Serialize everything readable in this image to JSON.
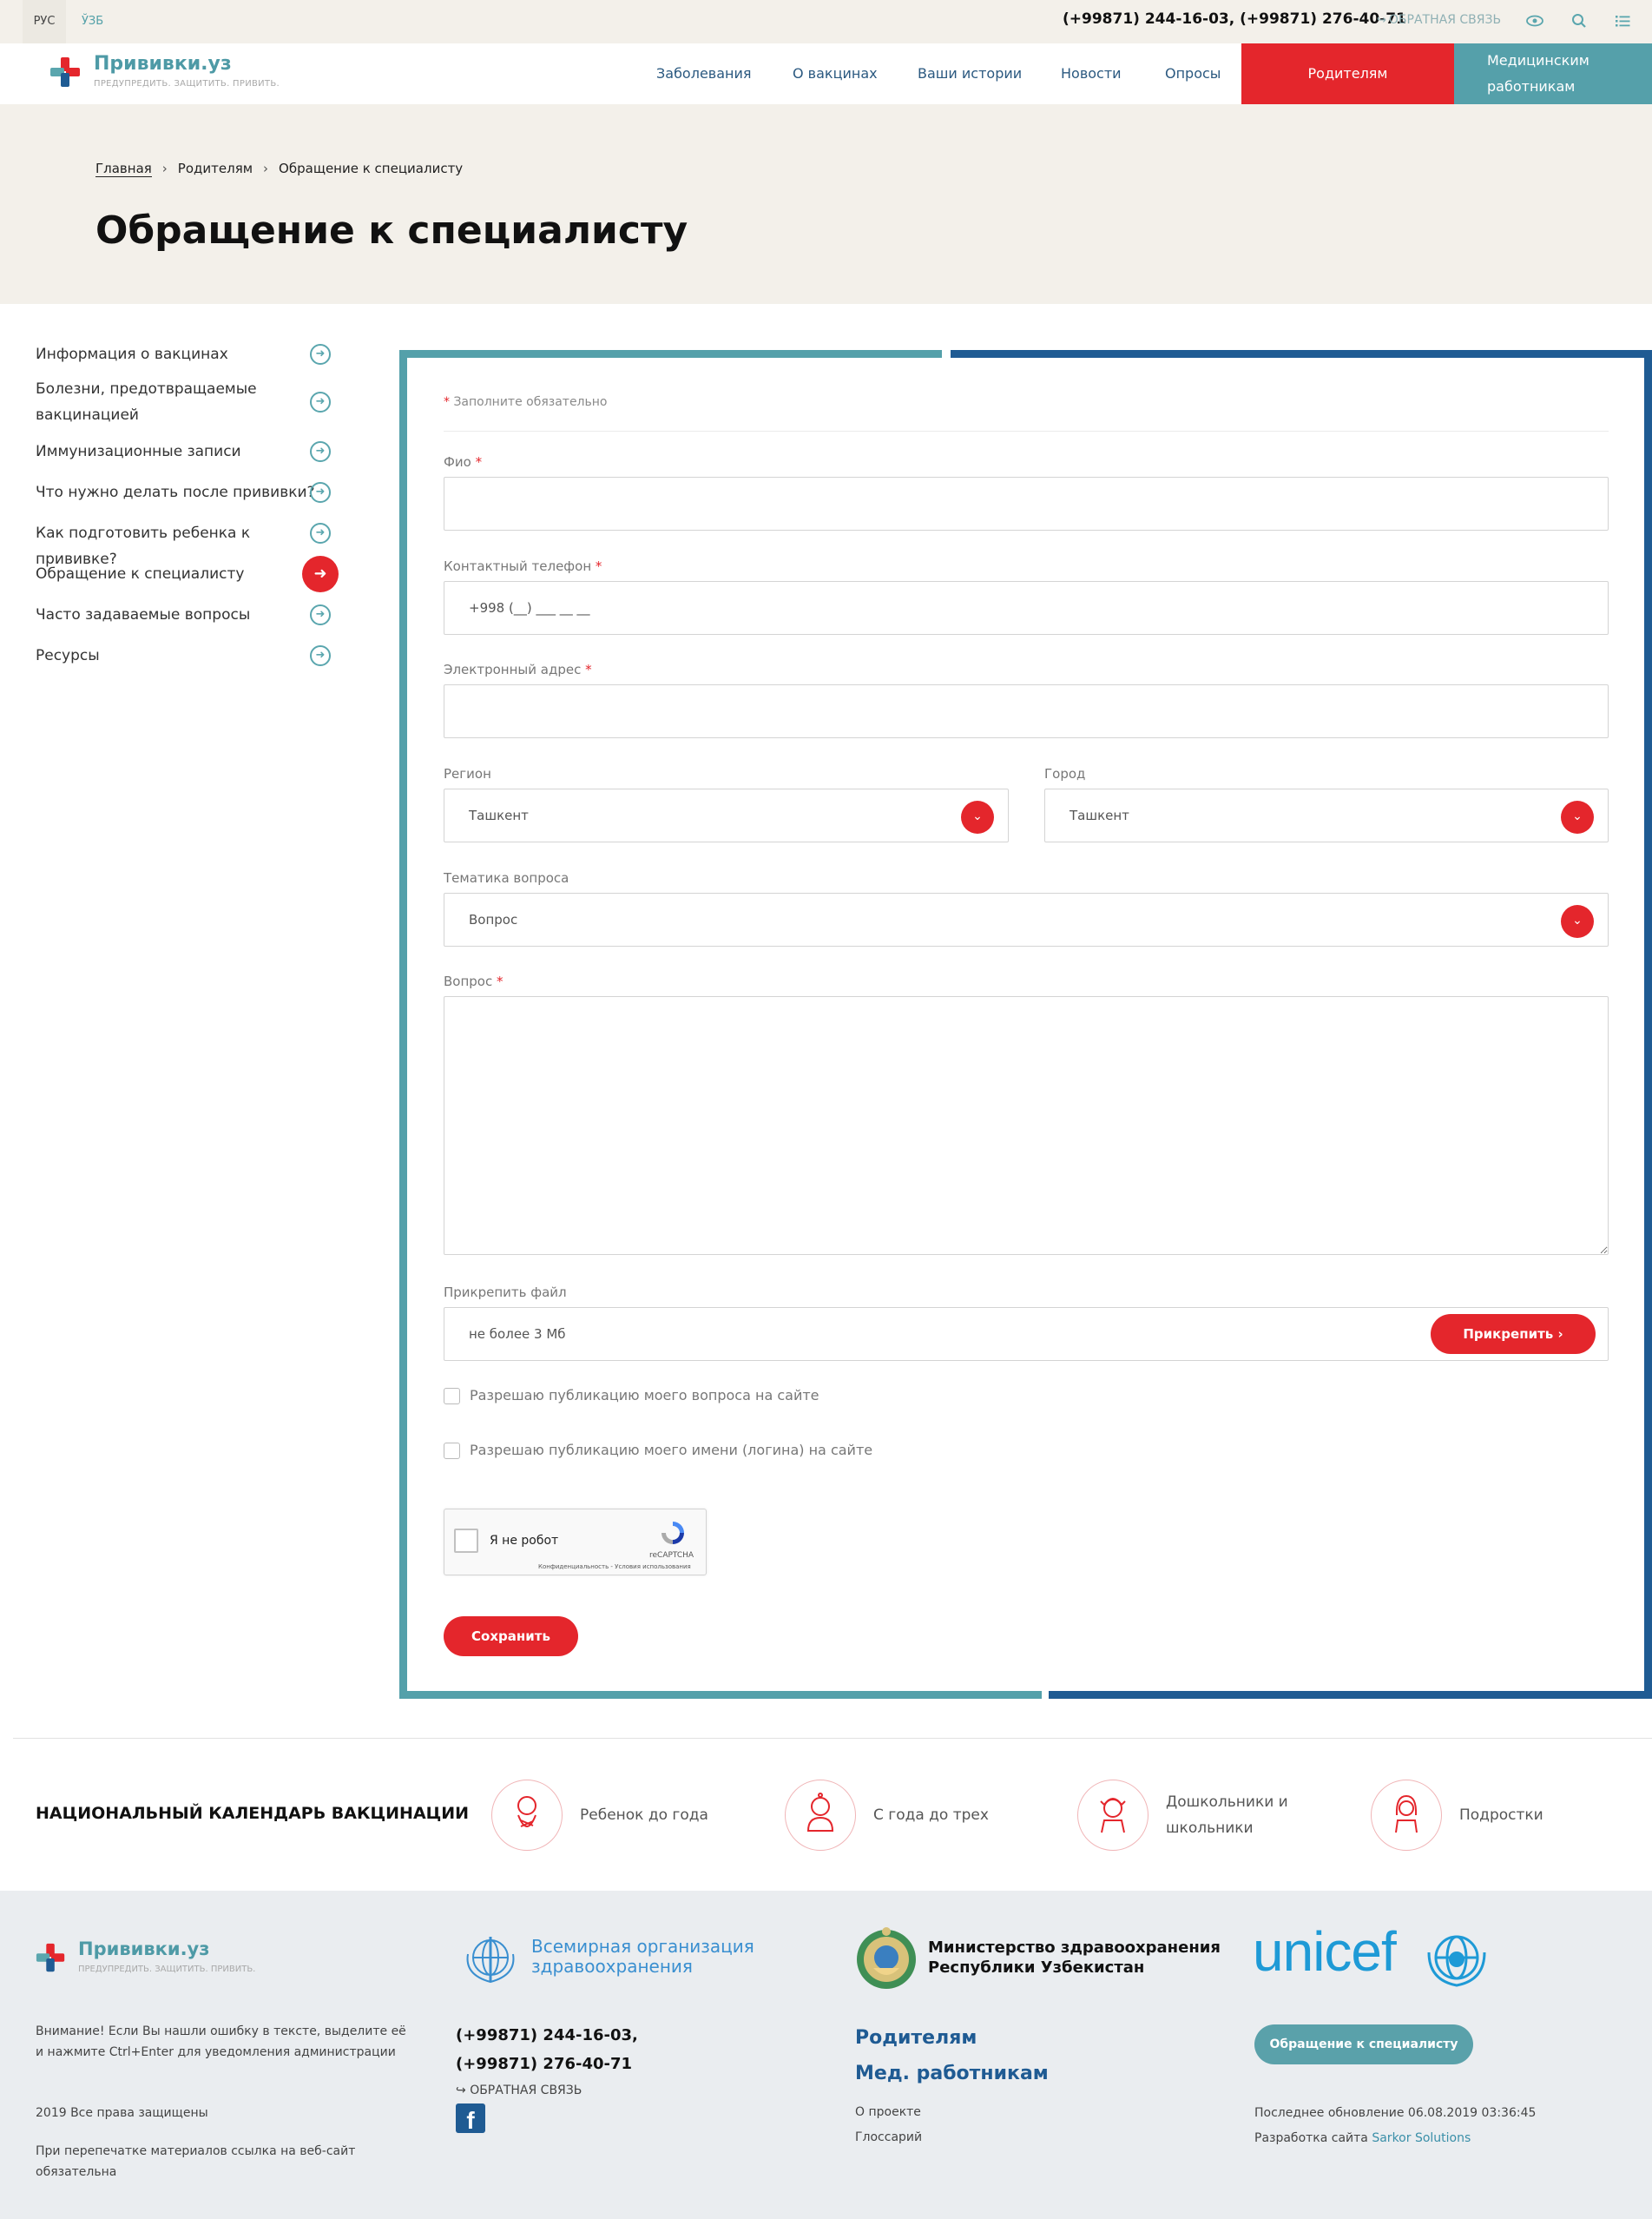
{
  "topbar": {
    "lang_ru": "РУС",
    "lang_uz": "ЎЗБ",
    "phones": "(+99871) 244-16-03, (+99871) 276-40-71",
    "feedback": "ОБРАТНАЯ СВЯЗЬ"
  },
  "header": {
    "logo_name": "Прививки.уз",
    "logo_tagline": "ПРЕДУПРЕДИТЬ. ЗАЩИТИТЬ. ПРИВИТЬ.",
    "nav": [
      "Заболевания",
      "О вакцинах",
      "Ваши истории",
      "Новости",
      "Опросы"
    ],
    "parents": "Родителям",
    "medics_line1": "Медицинским",
    "medics_line2": "работникам"
  },
  "breadcrumb": {
    "home": "Главная",
    "parents": "Родителям",
    "current": "Обращение к специалисту"
  },
  "page_title": "Обращение к специалисту",
  "sidebar": {
    "items": [
      "Информация о вакцинах",
      "Болезни, предотвращаемые",
      "вакцинацией",
      "Иммунизационные записи",
      "Что нужно делать после прививки?",
      "Как подготовить ребенка к прививке?",
      "Обращение к специалисту",
      "Часто задаваемые вопросы",
      "Ресурсы"
    ]
  },
  "form": {
    "required_note": "Заполните обязательно",
    "fio_label": "Фио",
    "phone_label": "Контактный телефон",
    "phone_value": "+998 (__) ___ __ __",
    "email_label": "Электронный адрес",
    "region_label": "Регион",
    "region_value": "Ташкент",
    "city_label": "Город",
    "city_value": "Ташкент",
    "topic_label": "Тематика вопроса",
    "topic_value": "Вопрос",
    "question_label": "Вопрос",
    "attach_label": "Прикрепить файл",
    "attach_hint": "не более 3 Мб",
    "attach_button": "Прикрепить",
    "consent_question": "Разрешаю публикацию моего вопроса на сайте",
    "consent_name": "Разрешаю публикацию моего имени (логина) на сайте",
    "captcha_text": "Я не робот",
    "captcha_brand": "reCAPTCHA",
    "captcha_legal": "Конфиденциальность - Условия использования",
    "save_button": "Сохранить"
  },
  "calendar": {
    "title": "НАЦИОНАЛЬНЫЙ КАЛЕНДАРЬ ВАКЦИНАЦИИ",
    "groups": [
      "Ребенок до года",
      "С года до трех",
      "Дошкольники и",
      "школьники",
      "Подростки"
    ]
  },
  "footer": {
    "logo_name": "Прививки.уз",
    "logo_tagline": "ПРЕДУПРЕДИТЬ. ЗАЩИТИТЬ. ПРИВИТЬ.",
    "notice_line1": "Внимание! Если Вы нашли ошибку в тексте, выделите её",
    "notice_line2": "и нажмите Ctrl+Enter для уведомления администрации",
    "copyright": "2019 Все права защищены",
    "reprint_line1": "При перепечатке материалов ссылка на веб-сайт",
    "reprint_line2": "обязательна",
    "who_line1": "Всемирная организация",
    "who_line2": "здравоохранения",
    "phone1": "(+99871) 244-16-03,",
    "phone2": "(+99871) 276-40-71",
    "feedback": "ОБРАТНАЯ СВЯЗЬ",
    "ministry_line1": "Министерство здравоохранения",
    "ministry_line2": "Республики Узбекистан",
    "parents": "Родителям",
    "medics": "Мед. работникам",
    "about": "О проекте",
    "glossary": "Глоссарий",
    "unicef": "unicef",
    "cta": "Обращение к специалисту",
    "updated": "Последнее обновление 06.08.2019 03:36:45",
    "dev_prefix": "Разработка сайта",
    "dev_name": "Sarkor Solutions"
  },
  "colors": {
    "accent_red": "#e4262c",
    "teal": "#55a0aa",
    "navy": "#1f5b93"
  }
}
